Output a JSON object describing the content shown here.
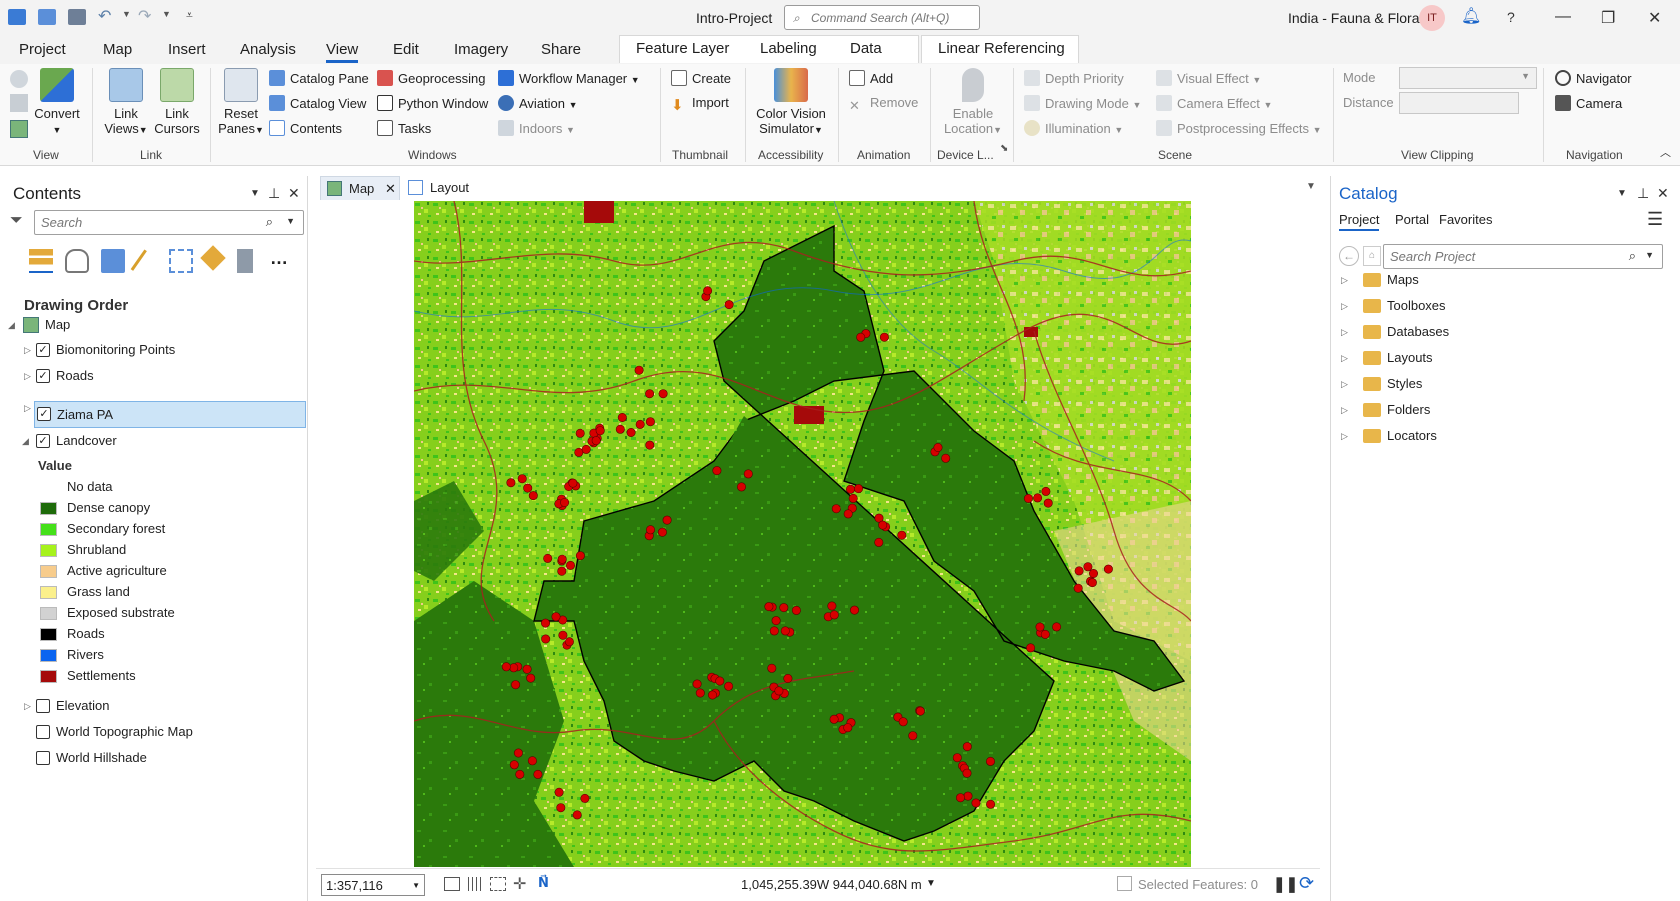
{
  "titlebar": {
    "app_title": "Intro-Project",
    "command_search_placeholder": "Command Search (Alt+Q)",
    "portal_name": "India - Fauna & Flora",
    "user_initials": "IT"
  },
  "ribbon_tabs": [
    "Project",
    "Map",
    "Insert",
    "Analysis",
    "View",
    "Edit",
    "Imagery",
    "Share"
  ],
  "active_tab": "View",
  "contextual_tabs": [
    "Feature Layer",
    "Labeling",
    "Data"
  ],
  "contextual_tab_2": "Linear Referencing",
  "ribbon": {
    "view_group": {
      "convert": "Convert",
      "label": "View"
    },
    "link_group": {
      "link_views_1": "Link",
      "link_views_2": "Views",
      "link_cursors_1": "Link",
      "link_cursors_2": "Cursors",
      "label": "Link"
    },
    "windows_group": {
      "reset_panes_1": "Reset",
      "reset_panes_2": "Panes",
      "catalog_pane": "Catalog Pane",
      "catalog_view": "Catalog View",
      "contents": "Contents",
      "geoprocessing": "Geoprocessing",
      "python_window": "Python Window",
      "tasks": "Tasks",
      "workflow_manager": "Workflow Manager",
      "aviation": "Aviation",
      "indoors": "Indoors",
      "label": "Windows"
    },
    "thumbnail_group": {
      "create": "Create",
      "import": "Import",
      "label": "Thumbnail"
    },
    "accessibility_group": {
      "cvs_1": "Color Vision",
      "cvs_2": "Simulator",
      "label": "Accessibility"
    },
    "animation_group": {
      "add": "Add",
      "remove": "Remove",
      "label": "Animation"
    },
    "device_group": {
      "enable_1": "Enable",
      "enable_2": "Location",
      "label": "Device L..."
    },
    "scene_group": {
      "depth_priority": "Depth Priority",
      "drawing_mode": "Drawing Mode",
      "illumination": "Illumination",
      "visual_effect": "Visual Effect",
      "camera_effect": "Camera Effect",
      "postprocessing": "Postprocessing Effects",
      "label": "Scene"
    },
    "clipping_group": {
      "mode": "Mode",
      "distance": "Distance",
      "label": "View Clipping"
    },
    "navigation_group": {
      "navigator": "Navigator",
      "camera": "Camera",
      "label": "Navigation"
    }
  },
  "contents": {
    "title": "Contents",
    "search_placeholder": "Search",
    "drawing_order": "Drawing Order",
    "map_node": "Map",
    "layers": [
      {
        "name": "Biomonitoring Points",
        "checked": true
      },
      {
        "name": "Roads",
        "checked": true
      },
      {
        "name": "Ziama PA",
        "checked": true,
        "selected": true
      },
      {
        "name": "Landcover",
        "checked": true,
        "expanded": true
      }
    ],
    "value_heading": "Value",
    "legend": [
      {
        "label": "No data",
        "color": ""
      },
      {
        "label": "Dense canopy",
        "color": "#1e6b0a"
      },
      {
        "label": "Secondary forest",
        "color": "#45e01a"
      },
      {
        "label": "Shrubland",
        "color": "#a6f21c"
      },
      {
        "label": "Active agriculture",
        "color": "#f7cc8c"
      },
      {
        "label": "Grass land",
        "color": "#fbf08c"
      },
      {
        "label": "Exposed substrate",
        "color": "#d2d2d2"
      },
      {
        "label": "Roads",
        "color": "#000000"
      },
      {
        "label": "Rivers",
        "color": "#0a64f0"
      },
      {
        "label": "Settlements",
        "color": "#a50a0a"
      }
    ],
    "other_layers": [
      {
        "name": "Elevation",
        "checked": false
      },
      {
        "name": "World Topographic Map",
        "checked": false
      },
      {
        "name": "World Hillshade",
        "checked": false
      }
    ]
  },
  "view_tabs": [
    "Map",
    "Layout"
  ],
  "status_bar": {
    "scale": "1:357,116",
    "coordinates": "1,045,255.39W 944,040.68N m",
    "selected_features": "Selected Features: 0"
  },
  "catalog": {
    "title": "Catalog",
    "tabs": [
      "Project",
      "Portal",
      "Favorites"
    ],
    "search_placeholder": "Search Project",
    "items": [
      "Maps",
      "Toolboxes",
      "Databases",
      "Layouts",
      "Styles",
      "Folders",
      "Locators"
    ]
  },
  "colors": {
    "accent": "#1a64c8",
    "dense_canopy": "#2b7a0b",
    "biomonitoring_point": "#d60000"
  }
}
